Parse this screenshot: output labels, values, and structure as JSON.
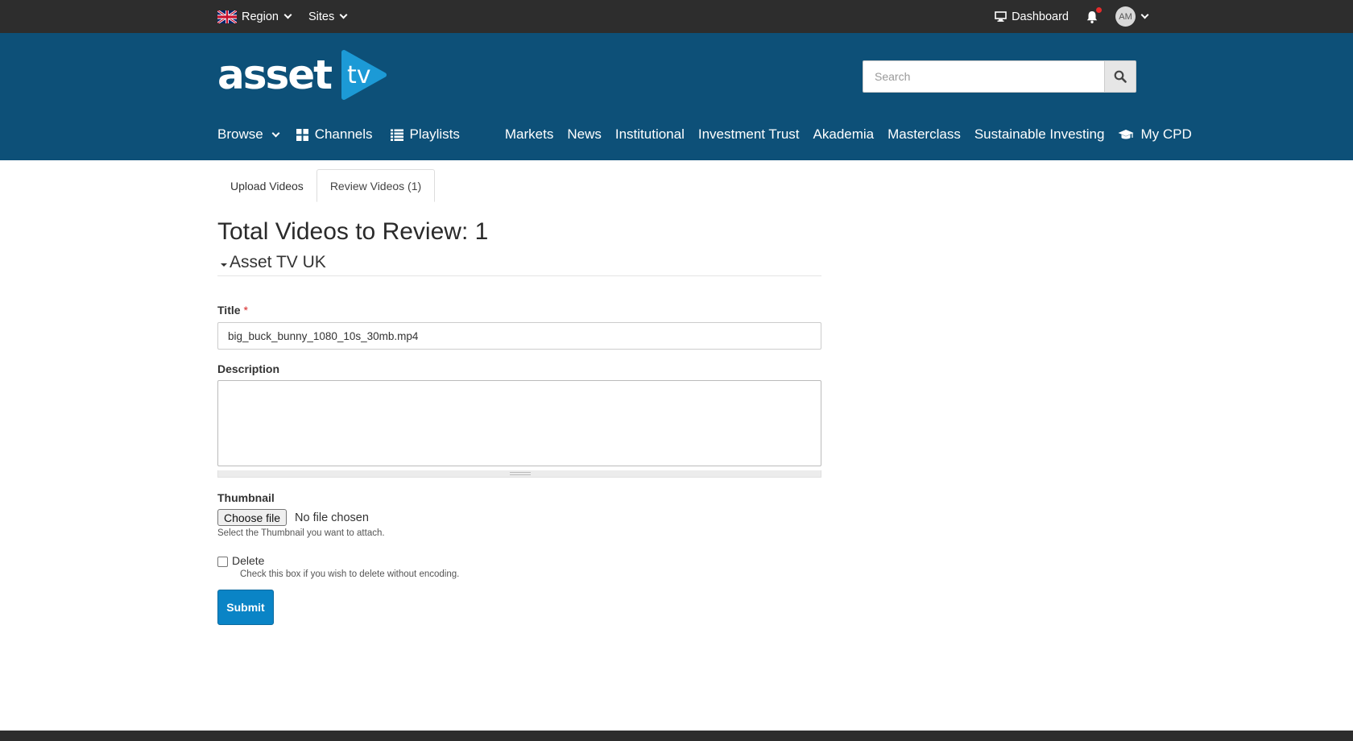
{
  "topbar": {
    "region_label": "Region",
    "sites_label": "Sites",
    "dashboard_label": "Dashboard",
    "avatar_initials": "AM"
  },
  "header": {
    "logo_text": "asset",
    "logo_mark_text": "tv",
    "search_placeholder": "Search"
  },
  "nav": {
    "browse": "Browse",
    "channels": "Channels",
    "playlists": "Playlists",
    "links": [
      "Markets",
      "News",
      "Institutional",
      "Investment Trust",
      "Akademia",
      "Masterclass",
      "Sustainable Investing"
    ],
    "my_cpd": "My CPD"
  },
  "tabs": [
    {
      "label": "Upload Videos",
      "active": false
    },
    {
      "label": "Review Videos (1)",
      "active": true
    }
  ],
  "main": {
    "title": "Total Videos to Review: 1",
    "group_name": "Asset TV UK",
    "form": {
      "title_label": "Title",
      "required_marker": "*",
      "title_value": "big_buck_bunny_1080_10s_30mb.mp4",
      "description_label": "Description",
      "description_value": "",
      "thumbnail_label": "Thumbnail",
      "choose_file_label": "Choose file",
      "no_file_text": "No file chosen",
      "thumbnail_help": "Select the Thumbnail you want to attach.",
      "delete_label": "Delete",
      "delete_help": "Check this box if you wish to delete without encoding.",
      "submit_label": "Submit"
    }
  },
  "colors": {
    "topbar_bg": "#2d2d2d",
    "header_bg": "#0d5078",
    "logo_blue": "#1c9ad6",
    "submit_bg": "#0a84c6",
    "required": "#d62626"
  }
}
